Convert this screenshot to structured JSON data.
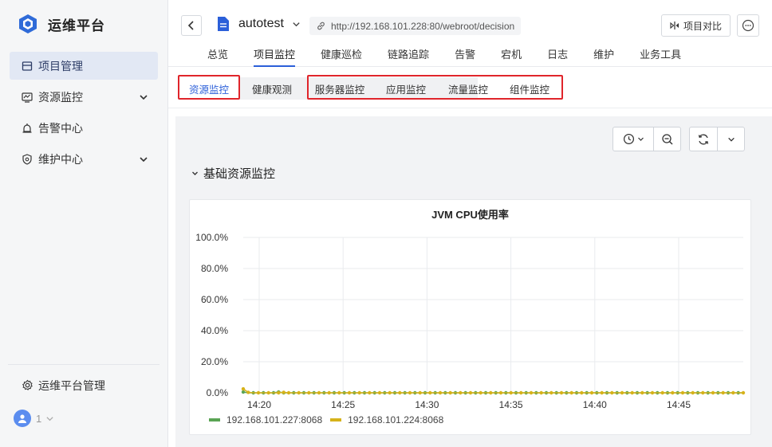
{
  "sidebar": {
    "brand": "运维平台",
    "items": [
      {
        "label": "项目管理",
        "icon": "project-icon",
        "active": true
      },
      {
        "label": "资源监控",
        "icon": "monitor-icon",
        "expandable": true
      },
      {
        "label": "告警中心",
        "icon": "alarm-icon"
      },
      {
        "label": "维护中心",
        "icon": "maintenance-icon",
        "expandable": true
      }
    ],
    "bottom_item": {
      "label": "运维平台管理",
      "icon": "gear-icon"
    },
    "user_count": "1"
  },
  "header": {
    "project_name": "autotest",
    "url": "http://192.168.101.228:80/webroot/decision",
    "compare_label": "项目对比",
    "tabs": [
      "总览",
      "项目监控",
      "健康巡检",
      "链路追踪",
      "告警",
      "宕机",
      "日志",
      "维护",
      "业务工具"
    ],
    "active_tab": "项目监控"
  },
  "subtabs": {
    "items": [
      "资源监控",
      "健康观测",
      "服务器监控",
      "应用监控",
      "流量监控",
      "组件监控"
    ],
    "active": "资源监控"
  },
  "section": {
    "title": "基础资源监控"
  },
  "colors": {
    "accent": "#2b5fd9",
    "series_green": "#5aa454",
    "series_yellow": "#d6b21a",
    "highlight": "#e0252b"
  },
  "chart_data": {
    "type": "line",
    "title": "JVM CPU使用率",
    "y_ticks": [
      "100.0%",
      "80.0%",
      "60.0%",
      "40.0%",
      "20.0%",
      "0.0%"
    ],
    "ylim": [
      0,
      100
    ],
    "x_ticks": [
      "14:20",
      "14:25",
      "14:30",
      "14:35",
      "14:40",
      "14:45"
    ],
    "x_range_minutes": [
      14.0,
      14.83
    ],
    "grid": true,
    "legend_position": "bottom-left",
    "series": [
      {
        "name": "192.168.101.227:8068",
        "color": "#5aa454",
        "values": [
          0.5,
          0,
          0,
          0,
          0,
          0,
          0,
          0.5,
          0,
          0,
          0,
          0,
          0,
          0,
          0,
          0,
          0,
          0,
          0,
          0,
          0,
          0,
          0,
          0,
          0,
          0,
          0,
          0,
          0,
          0,
          0,
          0,
          0,
          0,
          0,
          0,
          0,
          0,
          0,
          0,
          0,
          0,
          0,
          0,
          0,
          0,
          0,
          0,
          0,
          0,
          0,
          0,
          0,
          0,
          0,
          0,
          0,
          0,
          0,
          0,
          0,
          0,
          0,
          0,
          0,
          0,
          0,
          0,
          0,
          0,
          0,
          0,
          0,
          0,
          0,
          0,
          0,
          0,
          0,
          0,
          0,
          0,
          0,
          0,
          0,
          0,
          0,
          0,
          0,
          0,
          0,
          0,
          0,
          0,
          0,
          0,
          0,
          0,
          0,
          0
        ]
      },
      {
        "name": "192.168.101.224:8068",
        "color": "#d6b21a",
        "values": [
          2.5,
          0.3,
          0,
          0,
          0,
          0,
          0,
          0,
          0.3,
          0,
          0,
          0,
          0,
          0,
          0,
          0,
          0,
          0,
          0,
          0,
          0,
          0,
          0,
          0,
          0,
          0,
          0,
          0,
          0,
          0,
          0,
          0,
          0,
          0,
          0,
          0,
          0,
          0,
          0,
          0,
          0,
          0,
          0,
          0,
          0,
          0,
          0,
          0,
          0,
          0,
          0,
          0,
          0,
          0,
          0,
          0,
          0,
          0,
          0,
          0,
          0,
          0,
          0,
          0,
          0,
          0,
          0,
          0,
          0,
          0,
          0,
          0,
          0,
          0,
          0,
          0,
          0,
          0,
          0,
          0,
          0,
          0,
          0,
          0,
          0,
          0,
          0,
          0,
          0,
          0,
          0,
          0,
          0,
          0,
          0,
          0,
          0,
          0,
          0,
          0
        ]
      }
    ]
  }
}
